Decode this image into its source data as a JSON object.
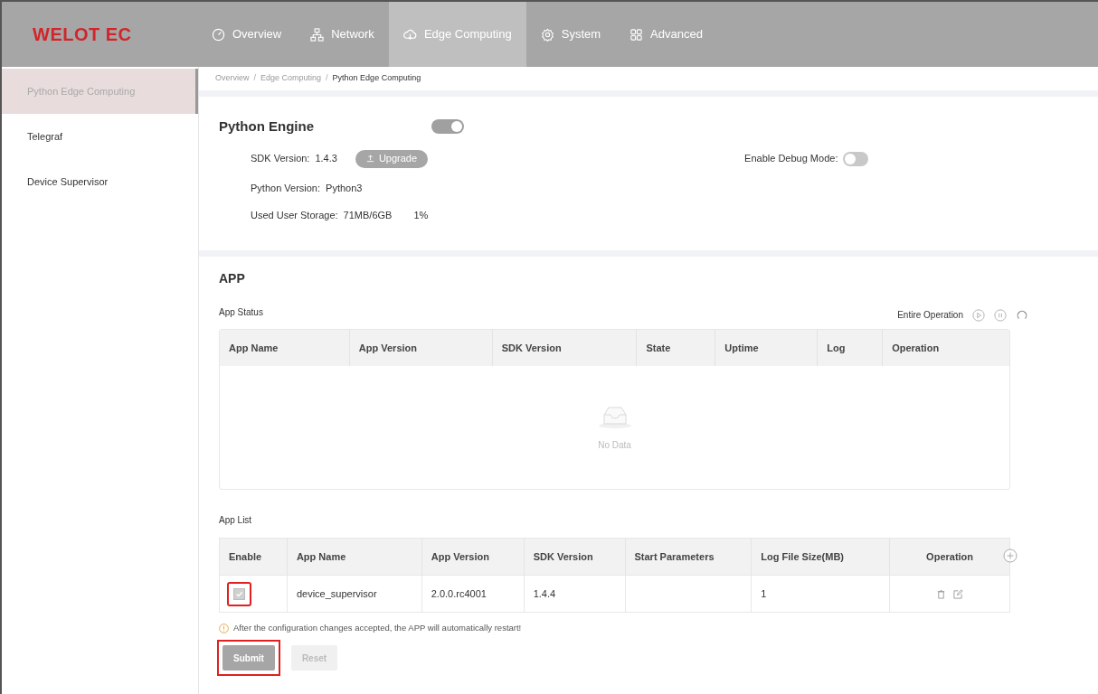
{
  "logo": "WELOT EC",
  "nav": [
    {
      "label": "Overview",
      "selected": false
    },
    {
      "label": "Network",
      "selected": false
    },
    {
      "label": "Edge Computing",
      "selected": true
    },
    {
      "label": "System",
      "selected": false
    },
    {
      "label": "Advanced",
      "selected": false
    }
  ],
  "sidebar": {
    "items": [
      {
        "label": "Python Edge Computing",
        "selected": true
      },
      {
        "label": "Telegraf",
        "selected": false
      },
      {
        "label": "Device Supervisor",
        "selected": false
      }
    ]
  },
  "breadcrumb": {
    "separator": "/",
    "items": [
      "Overview",
      "Edge Computing",
      "Python Edge Computing"
    ]
  },
  "engine": {
    "title": "Python Engine",
    "on": true,
    "sdk_label": "SDK Version:",
    "sdk_value": "1.4.3",
    "upgrade_button": "Upgrade",
    "debug_label": "Enable Debug Mode:",
    "debug_on": false,
    "python_label": "Python Version:",
    "python_value": "Python3",
    "storage_label": "Used User Storage:",
    "storage_value": "71MB/6GB",
    "storage_percent": "1%"
  },
  "app": {
    "title": "APP",
    "status_label": "App Status",
    "entire_operation": "Entire Operation",
    "status_table": {
      "columns": [
        "App Name",
        "App Version",
        "SDK Version",
        "State",
        "Uptime",
        "Log",
        "Operation"
      ],
      "empty_text": "No Data"
    },
    "list_label": "App List",
    "list_table": {
      "columns": [
        "Enable",
        "App Name",
        "App Version",
        "SDK Version",
        "Start Parameters",
        "Log File Size(MB)",
        "Operation"
      ],
      "rows": [
        {
          "checked": true,
          "highlighted": true,
          "app_name": "device_supervisor",
          "app_version": "2.0.0.rc4001",
          "sdk_version": "1.4.4",
          "log_size": "1"
        }
      ]
    },
    "notice": "After the configuration changes accepted, the APP will automatically restart!",
    "buttons": [
      {
        "label": "Submit",
        "kind": "primary",
        "highlighted": true
      },
      {
        "label": "Reset",
        "kind": "secondary",
        "highlighted": false
      }
    ]
  }
}
